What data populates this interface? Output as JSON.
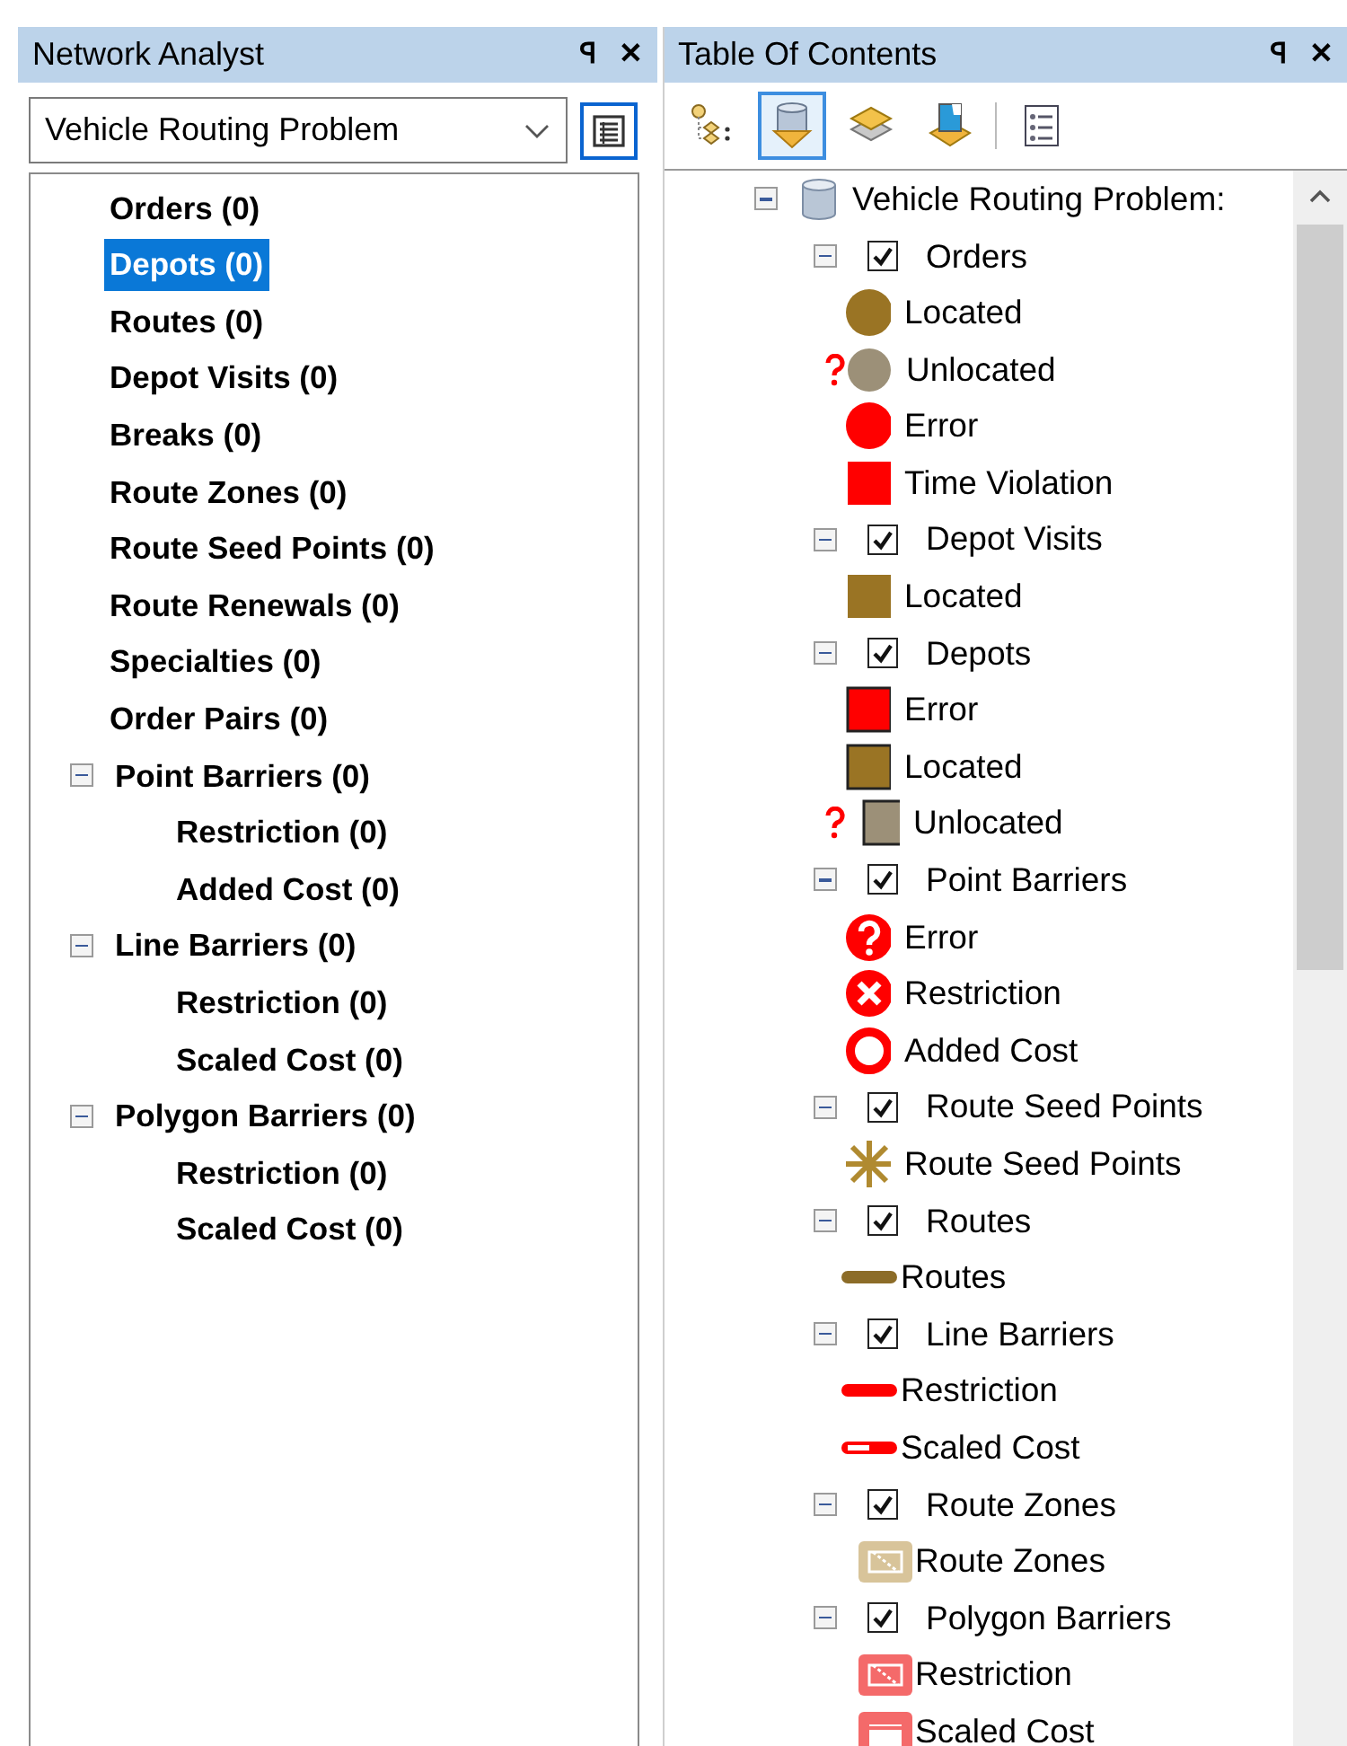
{
  "network_analyst": {
    "title": "Network Analyst",
    "pin": "ꟼ",
    "close": "✕",
    "dropdown": {
      "value": "Vehicle Routing Problem"
    },
    "tree": [
      {
        "label": "Orders (0)",
        "selected": false
      },
      {
        "label": "Depots (0)",
        "selected": true
      },
      {
        "label": "Routes (0)",
        "selected": false
      },
      {
        "label": "Depot Visits (0)",
        "selected": false
      },
      {
        "label": "Breaks (0)",
        "selected": false
      },
      {
        "label": "Route Zones (0)",
        "selected": false
      },
      {
        "label": "Route Seed Points (0)",
        "selected": false
      },
      {
        "label": "Route Renewals (0)",
        "selected": false
      },
      {
        "label": "Specialties (0)",
        "selected": false
      },
      {
        "label": "Order Pairs (0)",
        "selected": false
      },
      {
        "label": "Point Barriers (0)",
        "selected": false,
        "expanded": true,
        "children": [
          {
            "label": "Restriction (0)",
            "selected": false
          },
          {
            "label": "Added Cost (0)",
            "selected": false
          }
        ]
      },
      {
        "label": "Line Barriers (0)",
        "selected": false,
        "expanded": true,
        "children": [
          {
            "label": "Restriction (0)",
            "selected": false
          },
          {
            "label": "Scaled Cost (0)",
            "selected": false
          }
        ]
      },
      {
        "label": "Polygon Barriers (0)",
        "selected": false,
        "expanded": true,
        "children": [
          {
            "label": "Restriction (0)",
            "selected": false
          },
          {
            "label": "Scaled Cost (0)",
            "selected": false
          }
        ]
      }
    ]
  },
  "table_of_contents": {
    "title": "Table Of Contents",
    "pin": "ꟼ",
    "close": "✕",
    "toolbar": [
      {
        "kind": "list-by-drawing-order",
        "selected": false
      },
      {
        "kind": "list-by-source",
        "selected": true
      },
      {
        "kind": "list-by-visibility",
        "selected": false
      },
      {
        "kind": "list-by-selection",
        "selected": false
      },
      {
        "kind": "options",
        "selected": false
      }
    ],
    "root": {
      "label": "Vehicle Routing Problem:",
      "expanded": true
    },
    "layers": [
      {
        "label": "Orders",
        "checked": true,
        "expanded": true,
        "legend": [
          {
            "kind": "dot",
            "color": "#9a7424",
            "label": "Located"
          },
          {
            "kind": "dot-unlocated",
            "color": "#9c9078",
            "label": "Unlocated"
          },
          {
            "kind": "dot",
            "color": "#ff0000",
            "label": "Error"
          },
          {
            "kind": "square",
            "color": "#ff0000",
            "label": "Time Violation"
          }
        ]
      },
      {
        "label": "Depot Visits",
        "checked": true,
        "expanded": true,
        "legend": [
          {
            "kind": "square",
            "color": "#9a7424",
            "label": "Located"
          }
        ]
      },
      {
        "label": "Depots",
        "checked": true,
        "expanded": true,
        "legend": [
          {
            "kind": "square-outlined",
            "color": "#ff0000",
            "label": "Error"
          },
          {
            "kind": "square-outlined",
            "color": "#9a7424",
            "label": "Located"
          },
          {
            "kind": "square-unlocated",
            "color": "#9c9078",
            "label": "Unlocated"
          }
        ]
      },
      {
        "label": "Point Barriers",
        "checked": true,
        "expanded": true,
        "legend": [
          {
            "kind": "question-badge",
            "color": "#ff0000",
            "label": "Error"
          },
          {
            "kind": "x-badge",
            "color": "#ff0000",
            "label": "Restriction"
          },
          {
            "kind": "ring",
            "color": "#ff0000",
            "label": "Added Cost"
          }
        ]
      },
      {
        "label": "Route Seed Points",
        "checked": true,
        "expanded": true,
        "legend": [
          {
            "kind": "asterisk",
            "color": "#b08a30",
            "label": "Route Seed Points"
          }
        ]
      },
      {
        "label": "Routes",
        "checked": true,
        "expanded": true,
        "legend": [
          {
            "kind": "line",
            "color": "#8c6c28",
            "label": "Routes"
          }
        ]
      },
      {
        "label": "Line Barriers",
        "checked": true,
        "expanded": true,
        "legend": [
          {
            "kind": "line",
            "color": "#ff0000",
            "label": "Restriction"
          },
          {
            "kind": "line-hollow",
            "color": "#ff0000",
            "label": "Scaled Cost"
          }
        ]
      },
      {
        "label": "Route Zones",
        "checked": true,
        "expanded": true,
        "legend": [
          {
            "kind": "polygon",
            "color": "#d8c49a",
            "label": "Route Zones"
          }
        ]
      },
      {
        "label": "Polygon Barriers",
        "checked": true,
        "expanded": true,
        "legend": [
          {
            "kind": "polygon",
            "color": "#f46a6a",
            "label": "Restriction"
          },
          {
            "kind": "polygon-hollow",
            "color": "#f46a6a",
            "label": "Scaled Cost"
          }
        ]
      }
    ]
  }
}
